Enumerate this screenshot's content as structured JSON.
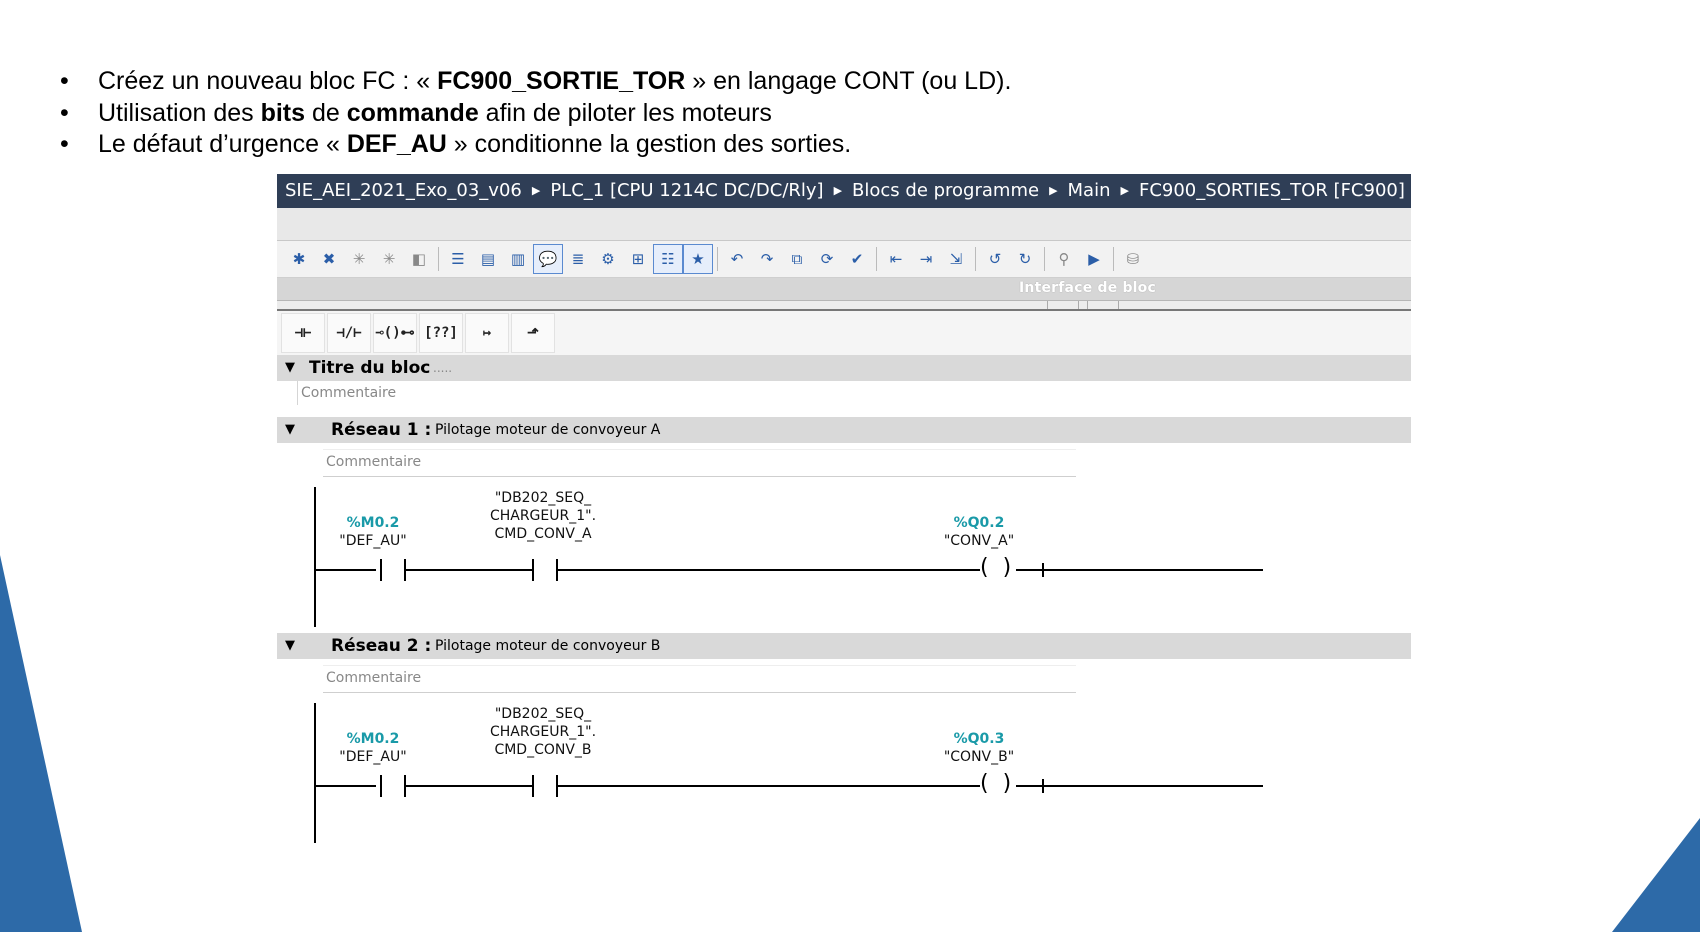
{
  "slide": {
    "bullets": [
      {
        "t1": "Créez un nouveau bloc FC : « ",
        "b1": "FC900_SORTIE_TOR",
        "t2": " » en langage CONT (ou LD).",
        "b2": "",
        "t3": ""
      },
      {
        "t1": "Utilisation des ",
        "b1": "bits",
        "t2": " de ",
        "b2": "commande",
        "t3": " afin de piloter les moteurs"
      },
      {
        "t1": "Le défaut d’urgence « ",
        "b1": "DEF_AU",
        "t2": " » conditionne la gestion des sorties.",
        "b2": "",
        "t3": ""
      }
    ],
    "colors": {
      "accent": "#2d6aa8",
      "pathbar": "#2f3e56",
      "address": "#1a9aa8"
    }
  },
  "editor": {
    "breadcrumb": [
      "SIE_AEI_2021_Exo_03_v06",
      "PLC_1 [CPU 1214C DC/DC/Rly]",
      "Blocs de programme",
      "Main",
      "FC900_SORTIES_TOR [FC900]"
    ],
    "interface_label": "Interface de bloc",
    "ladder_tools": [
      "contact-no-icon",
      "contact-nc-icon",
      "coil-icon",
      "empty-box-icon",
      "branch-open-icon",
      "branch-close-icon"
    ],
    "ladder_glyphs": [
      "⊣⊢",
      "⊣/⊢",
      "⊸()⊷",
      "[??]",
      "↦",
      "⬏"
    ],
    "block_title": "Titre du bloc",
    "block_title_dots": ".....",
    "block_comment": "Commentaire",
    "networks": [
      {
        "number": "Réseau 1 :",
        "title": "Pilotage moteur de convoyeur A",
        "comment": "Commentaire",
        "contact1": {
          "address": "%M0.2",
          "symbol": "\"DEF_AU\""
        },
        "contact2": {
          "line1": "\"DB202_SEQ_",
          "line2": "CHARGEUR_1\".",
          "line3": "CMD_CONV_A"
        },
        "coil": {
          "address": "%Q0.2",
          "symbol": "\"CONV_A\""
        }
      },
      {
        "number": "Réseau 2 :",
        "title": "Pilotage moteur de convoyeur B",
        "comment": "Commentaire",
        "contact1": {
          "address": "%M0.2",
          "symbol": "\"DEF_AU\""
        },
        "contact2": {
          "line1": "\"DB202_SEQ_",
          "line2": "CHARGEUR_1\".",
          "line3": "CMD_CONV_B"
        },
        "coil": {
          "address": "%Q0.3",
          "symbol": "\"CONV_B\""
        }
      }
    ]
  }
}
